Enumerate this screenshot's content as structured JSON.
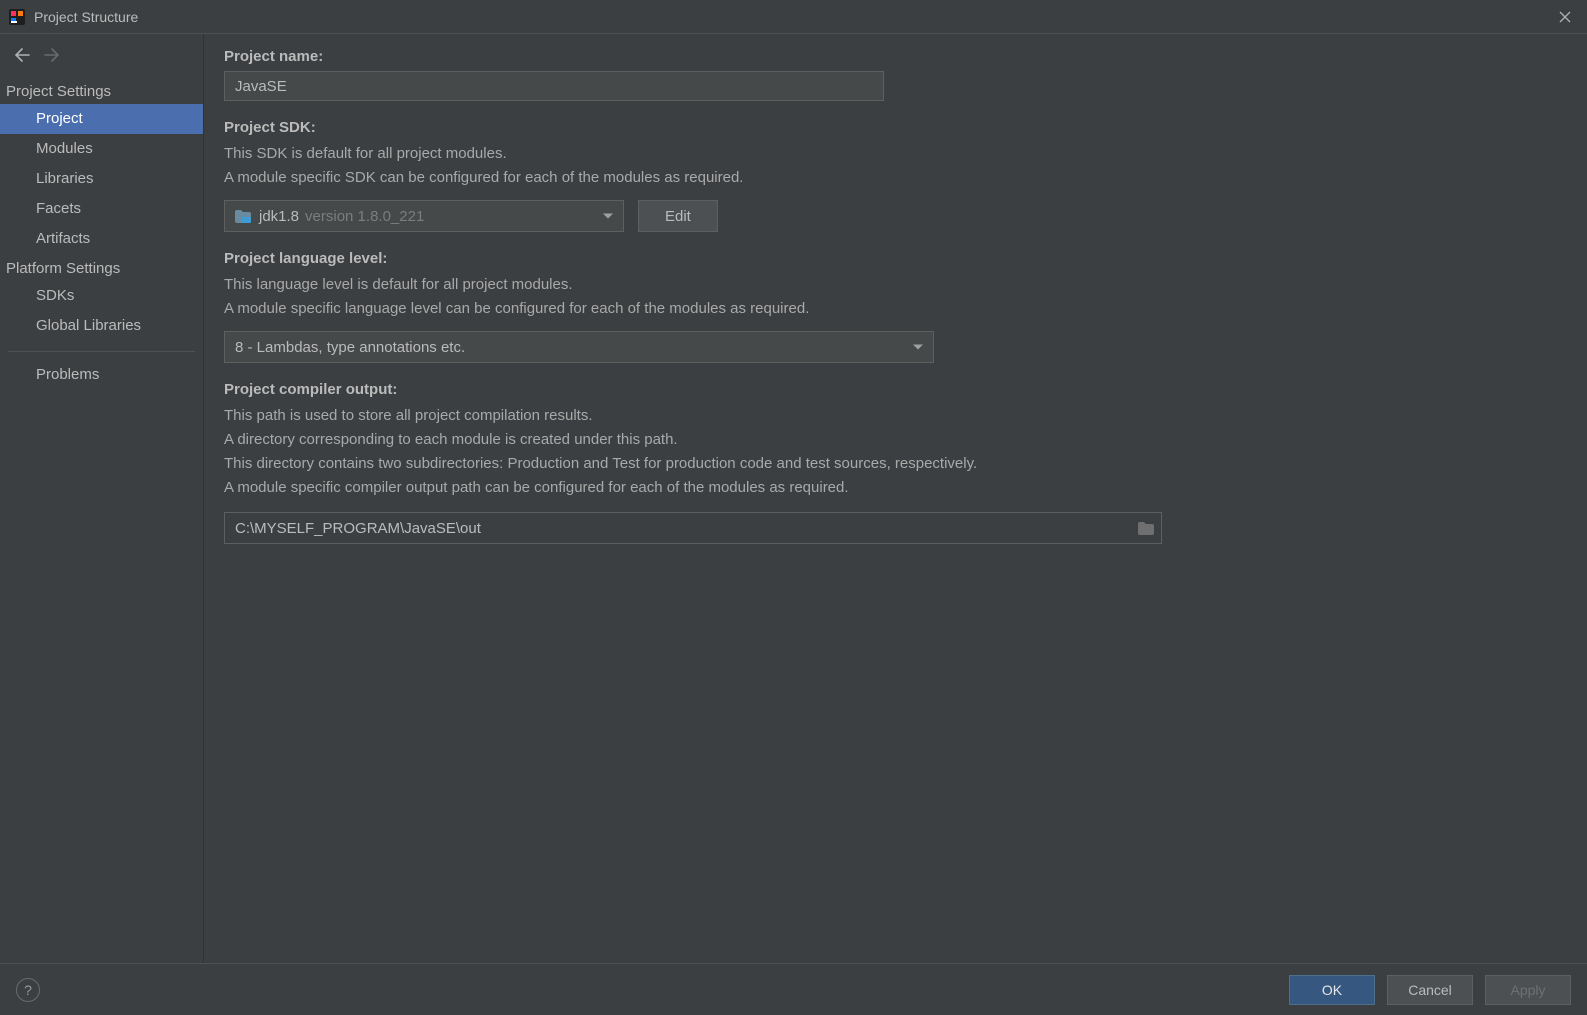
{
  "titlebar": {
    "title": "Project Structure"
  },
  "sidebar": {
    "groups": [
      {
        "heading": "Project Settings",
        "items": [
          {
            "label": "Project",
            "selected": true
          },
          {
            "label": "Modules"
          },
          {
            "label": "Libraries"
          },
          {
            "label": "Facets"
          },
          {
            "label": "Artifacts"
          }
        ]
      },
      {
        "heading": "Platform Settings",
        "items": [
          {
            "label": "SDKs"
          },
          {
            "label": "Global Libraries"
          }
        ]
      }
    ],
    "problems_label": "Problems"
  },
  "main": {
    "project_name_label": "Project name:",
    "project_name_value": "JavaSE",
    "sdk_label": "Project SDK:",
    "sdk_desc1": "This SDK is default for all project modules.",
    "sdk_desc2": "A module specific SDK can be configured for each of the modules as required.",
    "sdk_selected_name": "jdk1.8",
    "sdk_selected_version": "version 1.8.0_221",
    "edit_label": "Edit",
    "lang_label": "Project language level:",
    "lang_desc1": "This language level is default for all project modules.",
    "lang_desc2": "A module specific language level can be configured for each of the modules as required.",
    "lang_selected": "8 - Lambdas, type annotations etc.",
    "output_label": "Project compiler output:",
    "output_desc1": "This path is used to store all project compilation results.",
    "output_desc2": "A directory corresponding to each module is created under this path.",
    "output_desc3": "This directory contains two subdirectories: Production and Test for production code and test sources, respectively.",
    "output_desc4": "A module specific compiler output path can be configured for each of the modules as required.",
    "output_path": "C:\\MYSELF_PROGRAM\\JavaSE\\out"
  },
  "footer": {
    "ok": "OK",
    "cancel": "Cancel",
    "apply": "Apply",
    "help": "?"
  }
}
